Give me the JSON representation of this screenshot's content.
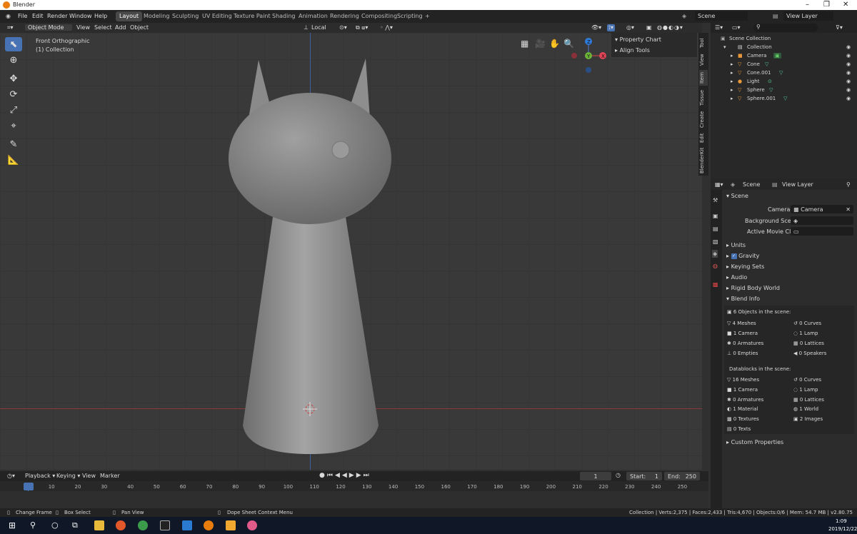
{
  "window": {
    "title": "Blender",
    "minimize": "–",
    "maximize": "❐",
    "close": "✕"
  },
  "menu": [
    "File",
    "Edit",
    "Render",
    "Window",
    "Help"
  ],
  "workspaces": [
    "Layout",
    "Modeling",
    "Sculpting",
    "UV Editing",
    "Texture Paint",
    "Shading",
    "Animation",
    "Rendering",
    "Compositing",
    "Scripting",
    "+"
  ],
  "top_right": {
    "scene": "Scene",
    "view_layer": "View Layer"
  },
  "viewport_header": {
    "mode": "Object Mode",
    "menus": [
      "View",
      "Select",
      "Add",
      "Object"
    ],
    "orientation": "Local"
  },
  "viewport": {
    "view_name": "Front Orthographic",
    "collection": "(1) Collection"
  },
  "npanel": {
    "items": [
      "Property Chart",
      "Align Tools"
    ]
  },
  "vtabs": [
    "Tool",
    "View",
    "Item",
    "Tissue",
    "Create",
    "Edit",
    "BlenderKit"
  ],
  "gizmo": {
    "z": "Z",
    "y": "Y",
    "x": "X"
  },
  "outliner": {
    "root": "Scene Collection",
    "collection": "Collection",
    "objects": [
      "Camera",
      "Cone",
      "Cone.001",
      "Light",
      "Sphere",
      "Sphere.001"
    ]
  },
  "props": {
    "tabs": {
      "scene": "Scene",
      "view_layer": "View Layer"
    },
    "scene_header": "Scene",
    "camera_label": "Camera",
    "camera_value": "Camera",
    "bg_scene_label": "Background Scene",
    "movie_clip_label": "Active Movie Clip",
    "sections": [
      "Units",
      "Gravity",
      "Keying Sets",
      "Audio",
      "Rigid Body World",
      "Blend Info"
    ],
    "blend_info_title": "6 Objects in the scene:",
    "objects_left": [
      "4 Meshes",
      "1 Camera",
      "0 Armatures",
      "0 Empties"
    ],
    "objects_right": [
      "0 Curves",
      "1 Lamp",
      "0 Lattices",
      "0 Speakers"
    ],
    "datablocks_title": "Datablocks in the scene:",
    "data_left": [
      "16 Meshes",
      "1 Camera",
      "0 Armatures",
      "1 Material",
      "0 Textures",
      "0 Texts"
    ],
    "data_right": [
      "0 Curves",
      "1 Lamp",
      "0 Lattices",
      "1 World",
      "2 Images"
    ],
    "custom": "Custom Properties"
  },
  "timeline": {
    "menus": [
      "Playback",
      "Keying",
      "View",
      "Marker"
    ],
    "current_frame": "1",
    "start_label": "Start:",
    "start": "1",
    "end_label": "End:",
    "end": "250",
    "ticks": [
      "1",
      "10",
      "20",
      "30",
      "40",
      "50",
      "60",
      "70",
      "80",
      "90",
      "100",
      "110",
      "120",
      "130",
      "140",
      "150",
      "160",
      "170",
      "180",
      "190",
      "200",
      "210",
      "220",
      "230",
      "240",
      "250"
    ]
  },
  "status": {
    "items": [
      "Change Frame",
      "Box Select",
      "Pan View",
      "Dope Sheet Context Menu"
    ],
    "right": "Collection | Verts:2,375 | Faces:2,433 | Tris:4,670 | Objects:0/6 | Mem: 54.7 MB | v2.80.75"
  },
  "taskbar": {
    "time": "1:09",
    "date": "2019/12/22"
  }
}
